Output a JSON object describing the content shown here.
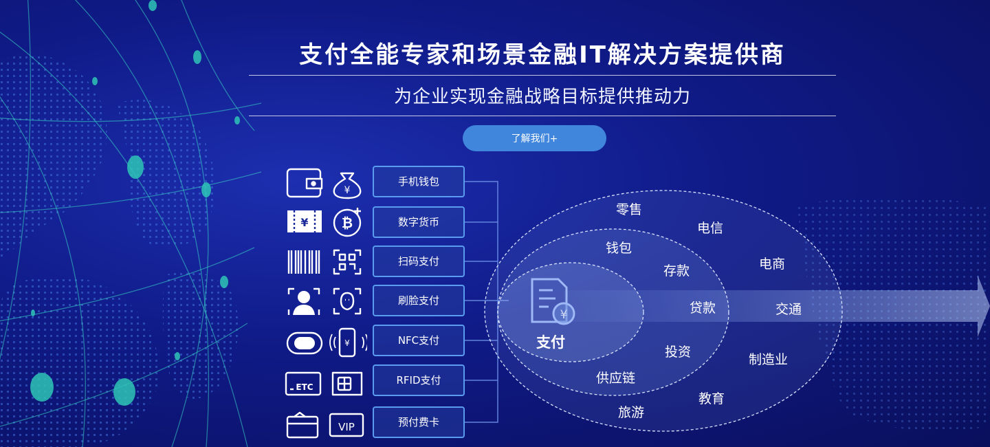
{
  "header": {
    "title": "支付全能专家和场景金融IT解决方案提供商",
    "subtitle": "为企业实现金融战略目标提供推动力",
    "about_button": "了解我们+"
  },
  "payments": [
    {
      "label": "手机钱包",
      "left_icon": "wallet-icon",
      "right_icon": "money-bag-icon"
    },
    {
      "label": "数字货币",
      "left_icon": "ticket-icon",
      "right_icon": "bitcoin-icon"
    },
    {
      "label": "扫码支付",
      "left_icon": "barcode-icon",
      "right_icon": "qr-code-icon"
    },
    {
      "label": "刷脸支付",
      "left_icon": "face-avatar-icon",
      "right_icon": "face-scan-icon"
    },
    {
      "label": "NFC支付",
      "left_icon": "wristband-icon",
      "right_icon": "phone-pay-icon"
    },
    {
      "label": "RFID支付",
      "left_icon": "etc-card-icon",
      "right_icon": "sim-card-icon"
    },
    {
      "label": "预付费卡",
      "left_icon": "prepaid-card-icon",
      "right_icon": "vip-card-icon"
    }
  ],
  "icons": {
    "etc_text": "ETC",
    "vip_text": "VIP"
  },
  "diagram": {
    "core": "支付",
    "inner": [
      "钱包",
      "存款",
      "贷款",
      "投资",
      "供应链"
    ],
    "outer": [
      "零售",
      "电信",
      "电商",
      "交通",
      "制造业",
      "教育",
      "旅游"
    ]
  },
  "colors": {
    "background": "#0f1a86",
    "accent_button": "#3f86dc",
    "box_border": "#5a9cf0",
    "globe_teal": "#2ec4b6"
  }
}
